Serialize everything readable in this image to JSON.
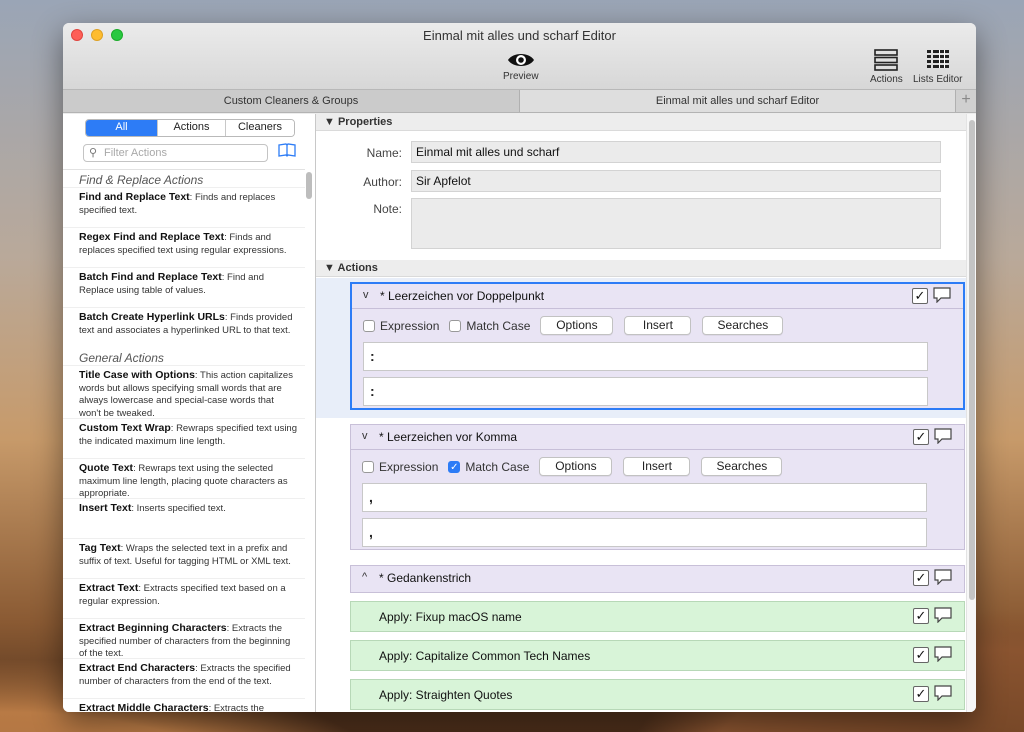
{
  "window": {
    "title": "Einmal mit alles und scharf Editor"
  },
  "toolbar": {
    "preview_label": "Preview",
    "actions_label": "Actions",
    "lists_editor_label": "Lists Editor"
  },
  "tabs": [
    {
      "label": "Custom Cleaners & Groups"
    },
    {
      "label": "Einmal mit alles und scharf Editor"
    }
  ],
  "sidebar": {
    "segments": [
      "All",
      "Actions",
      "Cleaners"
    ],
    "search_placeholder": "Filter Actions",
    "groups": [
      {
        "name": "Find & Replace Actions",
        "items": [
          {
            "title": "Find and Replace Text",
            "desc": ": Finds and replaces specified text."
          },
          {
            "title": "Regex Find and Replace Text",
            "desc": ": Finds and replaces specified text using regular expressions."
          },
          {
            "title": "Batch Find and Replace Text",
            "desc": ": Find and Replace using table of values."
          },
          {
            "title": "Batch Create Hyperlink URLs",
            "desc": ": Finds provided text and associates a hyperlinked URL to that text."
          }
        ]
      },
      {
        "name": "General Actions",
        "items": [
          {
            "title": "Title Case with Options",
            "desc": ": This action capitalizes words but allows specifying small words that are always lowercase and special-case words that won't be tweaked."
          },
          {
            "title": "Custom Text Wrap",
            "desc": ": Rewraps specified text using the indicated maximum line length."
          },
          {
            "title": "Quote Text",
            "desc": ": Rewraps text using the selected maximum line length, placing quote characters as appropriate."
          },
          {
            "title": "Insert Text",
            "desc": ": Inserts specified text."
          },
          {
            "title": "Tag Text",
            "desc": ": Wraps the selected text in a prefix and suffix of text. Useful for tagging HTML or XML text."
          },
          {
            "title": "Extract Text",
            "desc": ": Extracts specified text based on a regular expression."
          },
          {
            "title": "Extract Beginning Characters",
            "desc": ": Extracts the specified number of characters from the beginning of the text."
          },
          {
            "title": "Extract End Characters",
            "desc": ": Extracts the specified number of characters from the end of the text."
          },
          {
            "title": "Extract Middle Characters",
            "desc": ": Extracts the"
          }
        ]
      }
    ]
  },
  "properties": {
    "header": "Properties",
    "name_label": "Name:",
    "name_value": "Einmal mit alles und scharf",
    "author_label": "Author:",
    "author_value": "Sir Apfelot",
    "note_label": "Note:",
    "note_value": ""
  },
  "actions": {
    "header": "Actions",
    "items": [
      {
        "title": "* Leerzeichen vor Doppelpunkt",
        "chevron": "v",
        "expression_label": "Expression",
        "expression_checked": false,
        "match_case_label": "Match Case",
        "match_case_checked": false,
        "options_button": "Options",
        "insert_button": "Insert",
        "searches_button": "Searches",
        "find_text": " :",
        "replace_text": ":",
        "enabled_mark": "✓"
      },
      {
        "title": "* Leerzeichen vor Komma",
        "chevron": "v",
        "expression_label": "Expression",
        "expression_checked": false,
        "match_case_label": "Match Case",
        "match_case_checked": true,
        "options_button": "Options",
        "insert_button": "Insert",
        "searches_button": "Searches",
        "find_text": " ,",
        "replace_text": ",",
        "enabled_mark": "✓"
      },
      {
        "title": "* Gedankenstrich",
        "chevron": "^",
        "enabled_mark": "✓"
      },
      {
        "title": "Apply: Fixup macOS name",
        "enabled_mark": "✓"
      },
      {
        "title": "Apply: Capitalize Common Tech Names",
        "enabled_mark": "✓"
      },
      {
        "title": "Apply: Straighten Quotes",
        "enabled_mark": "✓"
      }
    ]
  },
  "colors": {
    "accent": "#2d7cf6",
    "action_card": "#e9e4f4",
    "apply_card": "#d8f4d8"
  }
}
